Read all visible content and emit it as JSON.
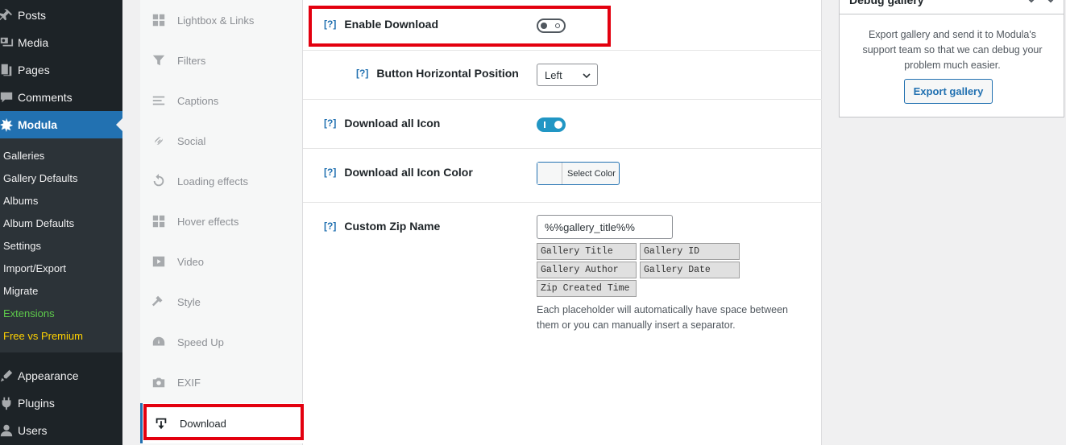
{
  "admin_menu": {
    "top_items": [
      {
        "label": "Posts",
        "icon": "pin-icon"
      },
      {
        "label": "Media",
        "icon": "media-icon"
      },
      {
        "label": "Pages",
        "icon": "pages-icon"
      },
      {
        "label": "Comments",
        "icon": "comments-icon"
      },
      {
        "label": "Modula",
        "icon": "modula-icon"
      }
    ],
    "sub_items": [
      "Galleries",
      "Gallery Defaults",
      "Albums",
      "Album Defaults",
      "Settings",
      "Import/Export",
      "Migrate",
      "Extensions",
      "Free vs Premium"
    ],
    "bottom_items": [
      {
        "label": "Appearance",
        "icon": "appearance-icon"
      },
      {
        "label": "Plugins",
        "icon": "plugins-icon"
      },
      {
        "label": "Users",
        "icon": "users-icon"
      }
    ]
  },
  "settings_tabs": [
    {
      "label": "Lightbox & Links",
      "icon": "grid-icon"
    },
    {
      "label": "Filters",
      "icon": "filter-icon"
    },
    {
      "label": "Captions",
      "icon": "lines-icon"
    },
    {
      "label": "Social",
      "icon": "link-icon"
    },
    {
      "label": "Loading effects",
      "icon": "reload-icon"
    },
    {
      "label": "Hover effects",
      "icon": "grid-icon"
    },
    {
      "label": "Video",
      "icon": "play-icon"
    },
    {
      "label": "Style",
      "icon": "hammer-icon"
    },
    {
      "label": "Speed Up",
      "icon": "dashboard-icon"
    },
    {
      "label": "EXIF",
      "icon": "camera-icon"
    },
    {
      "label": "Download",
      "icon": "download-icon"
    }
  ],
  "download_settings": {
    "help_marker": "[?]",
    "enable_download": {
      "label": "Enable Download",
      "enabled": false
    },
    "button_position": {
      "label": "Button Horizontal Position",
      "value": "Left"
    },
    "download_all_icon": {
      "label": "Download all Icon",
      "enabled": true
    },
    "icon_color": {
      "label": "Download all Icon Color",
      "button": "Select Color"
    },
    "zip_name": {
      "label": "Custom Zip Name",
      "value": "%%gallery_title%%",
      "placeholders": [
        "Gallery Title",
        "Gallery ID",
        "Gallery Author",
        "Gallery Date",
        "Zip Created Time"
      ],
      "hint": "Each placeholder will automatically have space between them or you can manually insert a separator."
    }
  },
  "debug_box": {
    "title": "Debug gallery",
    "description": "Export gallery and send it to Modula's support team so that we can debug your problem much easier.",
    "button": "Export gallery"
  },
  "colors": {
    "admin_bg": "#1d2327",
    "accent": "#2271b1",
    "highlight": "#e3000f",
    "toggle_on": "#2196c4"
  }
}
